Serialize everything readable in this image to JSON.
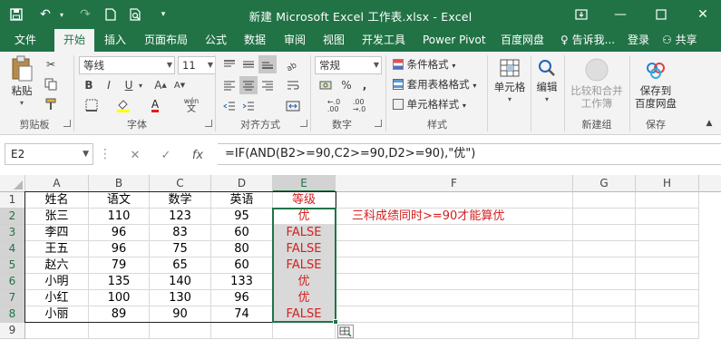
{
  "window": {
    "title": "新建 Microsoft Excel 工作表.xlsx - Excel"
  },
  "tabs": [
    "文件",
    "开始",
    "插入",
    "页面布局",
    "公式",
    "数据",
    "审阅",
    "视图",
    "开发工具",
    "Power Pivot",
    "百度网盘"
  ],
  "tab_right": {
    "tell_me": "告诉我...",
    "login": "登录",
    "share": "共享"
  },
  "ribbon": {
    "paste_label": "粘贴",
    "clipboard_label": "剪贴板",
    "font_name": "等线",
    "font_size": "11",
    "font_group_label": "字体",
    "bold": "B",
    "italic": "I",
    "underline": "U",
    "font_color_letter": "A",
    "wen": "wén",
    "alignment_label": "对齐方式",
    "number_format": "常规",
    "percent": "%",
    "comma": ",",
    "number_label": "数字",
    "cond_format": "条件格式",
    "table_format": "套用表格格式",
    "cell_style": "单元格样式",
    "styles_label": "样式",
    "cells_label": "单元格",
    "editing_label": "编辑",
    "compare_label_1": "比较和合并",
    "compare_label_2": "工作簿",
    "new_group_label": "新建组",
    "save_label_1": "保存到",
    "save_label_2": "百度网盘",
    "save_group_label": "保存"
  },
  "formula_bar": {
    "name_box": "E2",
    "formula": "=IF(AND(B2>=90,C2>=90,D2>=90),\"优\")"
  },
  "columns": [
    "A",
    "B",
    "C",
    "D",
    "E",
    "F",
    "G",
    "H"
  ],
  "rows": [
    "1",
    "2",
    "3",
    "4",
    "5",
    "6",
    "7",
    "8",
    "9"
  ],
  "table": {
    "header": [
      "姓名",
      "语文",
      "数学",
      "英语",
      "等级"
    ],
    "data": [
      [
        "张三",
        "110",
        "123",
        "95",
        "优"
      ],
      [
        "李四",
        "96",
        "83",
        "60",
        "FALSE"
      ],
      [
        "王五",
        "96",
        "75",
        "80",
        "FALSE"
      ],
      [
        "赵六",
        "79",
        "65",
        "60",
        "FALSE"
      ],
      [
        "小明",
        "135",
        "140",
        "133",
        "优"
      ],
      [
        "小红",
        "100",
        "130",
        "96",
        "优"
      ],
      [
        "小丽",
        "89",
        "90",
        "74",
        "FALSE"
      ]
    ]
  },
  "annotation": "三科成绩同时>=90才能算优",
  "colors": {
    "excel_green": "#217346",
    "annotation_red": "#d32020",
    "selected_fill": "#d9d9d9"
  }
}
